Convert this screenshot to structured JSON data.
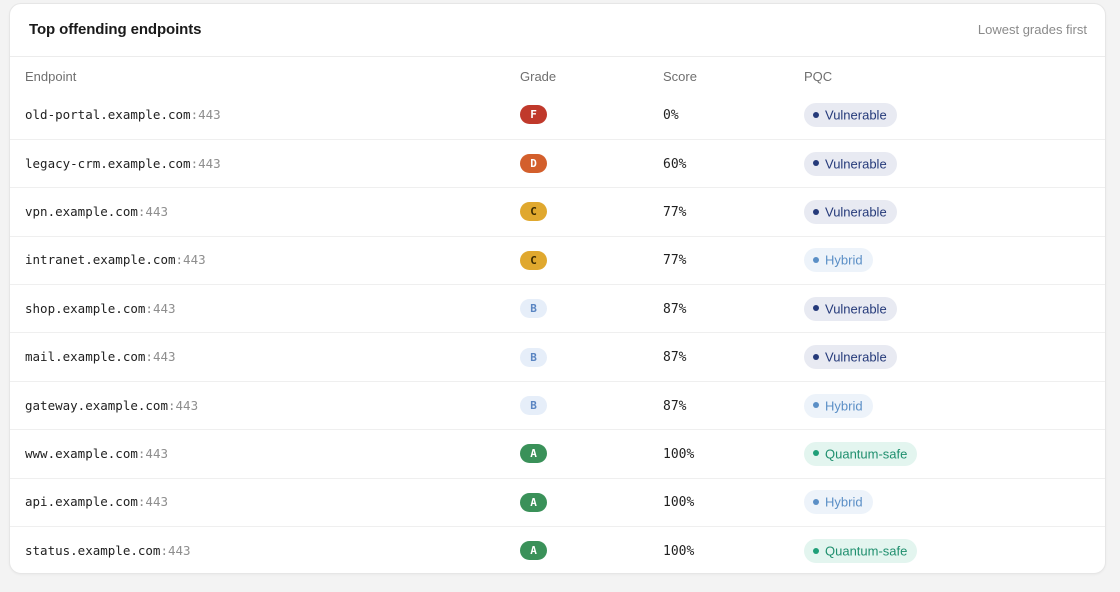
{
  "card": {
    "title": "Top offending endpoints",
    "subtitle": "Lowest grades first"
  },
  "columns": {
    "endpoint": "Endpoint",
    "grade": "Grade",
    "score": "Score",
    "pqc": "PQC"
  },
  "colors": {
    "grade": {
      "F": {
        "bg": "#c0392b",
        "fg": "#ffffff"
      },
      "D": {
        "bg": "#d35f2c",
        "fg": "#ffffff"
      },
      "C": {
        "bg": "#e0a82e",
        "fg": "#3a2a00"
      },
      "B": {
        "bg": "#e6eef9",
        "fg": "#5a85c2"
      },
      "A": {
        "bg": "#3a9159",
        "fg": "#ffffff"
      }
    },
    "pqc": {
      "Vulnerable": {
        "bg": "#e8eaf2",
        "fg": "#253a7a",
        "dot": "#253a7a"
      },
      "Hybrid": {
        "bg": "#edf3fa",
        "fg": "#5b8fc6",
        "dot": "#5b8fc6"
      },
      "Quantum-safe": {
        "bg": "#e3f5ef",
        "fg": "#1f8f6e",
        "dot": "#1f9f78"
      }
    }
  },
  "rows": [
    {
      "host": "old-portal.example.com",
      "port": ":443",
      "grade": "F",
      "score": "0%",
      "pqc": "Vulnerable"
    },
    {
      "host": "legacy-crm.example.com",
      "port": ":443",
      "grade": "D",
      "score": "60%",
      "pqc": "Vulnerable"
    },
    {
      "host": "vpn.example.com",
      "port": ":443",
      "grade": "C",
      "score": "77%",
      "pqc": "Vulnerable"
    },
    {
      "host": "intranet.example.com",
      "port": ":443",
      "grade": "C",
      "score": "77%",
      "pqc": "Hybrid"
    },
    {
      "host": "shop.example.com",
      "port": ":443",
      "grade": "B",
      "score": "87%",
      "pqc": "Vulnerable"
    },
    {
      "host": "mail.example.com",
      "port": ":443",
      "grade": "B",
      "score": "87%",
      "pqc": "Vulnerable"
    },
    {
      "host": "gateway.example.com",
      "port": ":443",
      "grade": "B",
      "score": "87%",
      "pqc": "Hybrid"
    },
    {
      "host": "www.example.com",
      "port": ":443",
      "grade": "A",
      "score": "100%",
      "pqc": "Quantum-safe"
    },
    {
      "host": "api.example.com",
      "port": ":443",
      "grade": "A",
      "score": "100%",
      "pqc": "Hybrid"
    },
    {
      "host": "status.example.com",
      "port": ":443",
      "grade": "A",
      "score": "100%",
      "pqc": "Quantum-safe"
    }
  ]
}
